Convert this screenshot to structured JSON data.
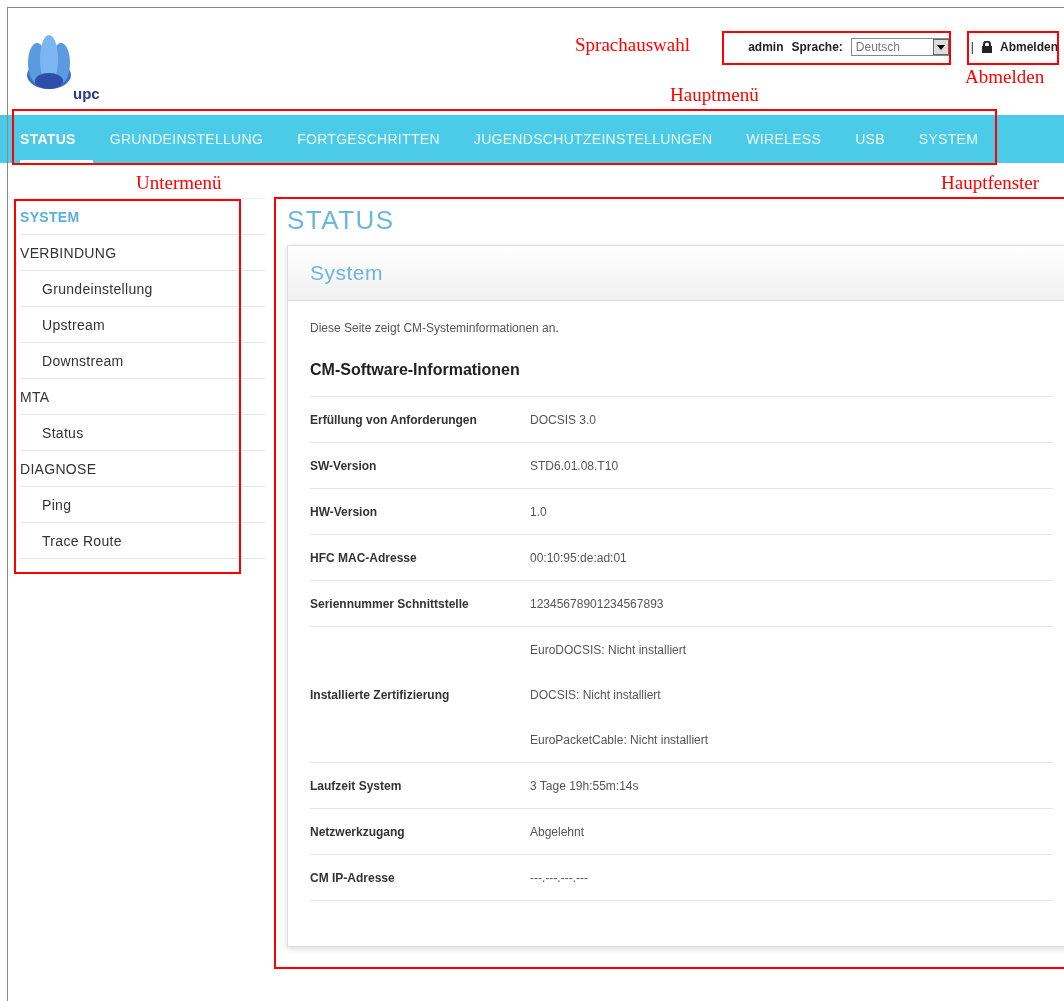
{
  "logo": {
    "text": "upc"
  },
  "header": {
    "user": "admin",
    "language_label": "Sprache:",
    "language_value": "Deutsch",
    "separator": "|",
    "logout": "Abmelden"
  },
  "nav": [
    {
      "label": "STATUS",
      "selected": true
    },
    {
      "label": "GRUNDEINSTELLUNG",
      "selected": false
    },
    {
      "label": "FORTGESCHRITTEN",
      "selected": false
    },
    {
      "label": "JUGENDSCHUTZEINSTELLUNGEN",
      "selected": false
    },
    {
      "label": "WIRELESS",
      "selected": false
    },
    {
      "label": "USB",
      "selected": false
    },
    {
      "label": "SYSTEM",
      "selected": false
    }
  ],
  "sidebar": [
    {
      "label": "SYSTEM",
      "selected": true
    },
    {
      "label": "VERBINDUNG",
      "selected": false,
      "children": [
        {
          "label": "Grundeinstellung",
          "selected": false
        },
        {
          "label": "Upstream",
          "selected": false
        },
        {
          "label": "Downstream",
          "selected": false
        }
      ]
    },
    {
      "label": "MTA",
      "selected": false,
      "children": [
        {
          "label": "Status",
          "selected": false
        }
      ]
    },
    {
      "label": "DIAGNOSE",
      "selected": false,
      "children": [
        {
          "label": "Ping",
          "selected": false
        },
        {
          "label": "Trace Route",
          "selected": false
        }
      ]
    }
  ],
  "main": {
    "title": "STATUS",
    "card_title": "System",
    "description": "Diese Seite zeigt CM-Systeminformationen an.",
    "section_title": "CM-Software-Informationen",
    "rows": [
      {
        "label": "Erfüllung von Anforderungen",
        "values": [
          "DOCSIS 3.0"
        ]
      },
      {
        "label": "SW-Version",
        "values": [
          "STD6.01.08.T10"
        ]
      },
      {
        "label": "HW-Version",
        "values": [
          "1.0"
        ]
      },
      {
        "label": "HFC MAC-Adresse",
        "values": [
          "00:10:95:de:ad:01"
        ]
      },
      {
        "label": "Seriennummer Schnittstelle",
        "values": [
          "12345678901234567893"
        ]
      },
      {
        "label": "Installierte Zertifizierung",
        "values": [
          "EuroDOCSIS: Nicht installiert",
          "DOCSIS: Nicht installiert",
          "EuroPacketCable: Nicht installiert"
        ]
      },
      {
        "label": "Laufzeit System",
        "values": [
          "3 Tage 19h:55m:14s"
        ]
      },
      {
        "label": "Netzwerkzugang",
        "values": [
          "Abgelehnt"
        ]
      },
      {
        "label": "CM IP-Adresse",
        "values": [
          "---.---.---.---"
        ]
      }
    ]
  },
  "annotations": [
    {
      "label": "Sprachauswahl"
    },
    {
      "label": "Abmelden"
    },
    {
      "label": "Hauptmenü"
    },
    {
      "label": "Untermenü"
    },
    {
      "label": "Hauptfenster"
    }
  ]
}
